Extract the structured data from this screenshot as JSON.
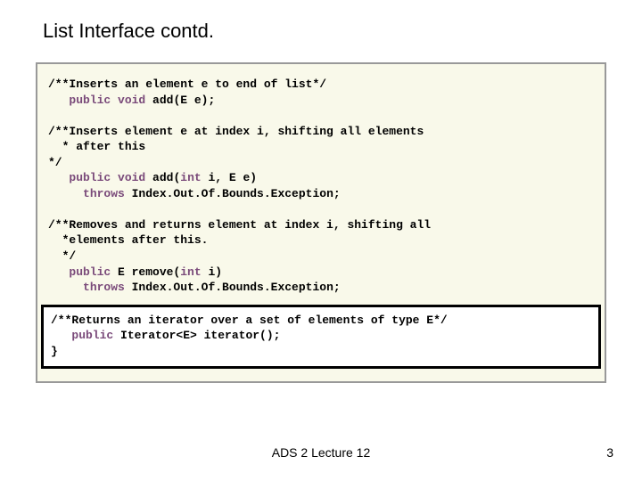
{
  "title": "List Interface contd.",
  "footer": "ADS 2 Lecture 12",
  "page": "3",
  "code": {
    "c1": "/**Inserts an element e to end of list*/",
    "sig1_pre": "   ",
    "kw_public1": "public",
    "sig1_mid1": " ",
    "kw_void1": "void",
    "sig1_rest": " add(E e);",
    "blank1": " ",
    "c2a": "/**Inserts element e at index i, shifting all elements",
    "c2b": "  * after this",
    "c2c": "*/",
    "sig2_pre": "   ",
    "kw_public2": "public",
    "sig2_mid1": " ",
    "kw_void2": "void",
    "sig2_mid2": " add(",
    "kw_int2": "int",
    "sig2_rest": " i, E e)",
    "throws2_pre": "     ",
    "kw_throws2": "throws",
    "throws2_rest": " Index.Out.Of.Bounds.Exception;",
    "blank2": " ",
    "c3a": "/**Removes and returns element at index i, shifting all",
    "c3b": "  *elements after this.",
    "c3c": "  */",
    "sig3_pre": "   ",
    "kw_public3": "public",
    "sig3_mid1": " E remove(",
    "kw_int3": "int",
    "sig3_rest": " i)",
    "throws3_pre": "     ",
    "kw_throws3": "throws",
    "throws3_rest": " Index.Out.Of.Bounds.Exception;",
    "hc": "/**Returns an iterator over a set of elements of type E*/",
    "hsig_pre": "   ",
    "kw_public4": "public",
    "hsig_rest": " Iterator<E> iterator();",
    "brace": "}"
  }
}
